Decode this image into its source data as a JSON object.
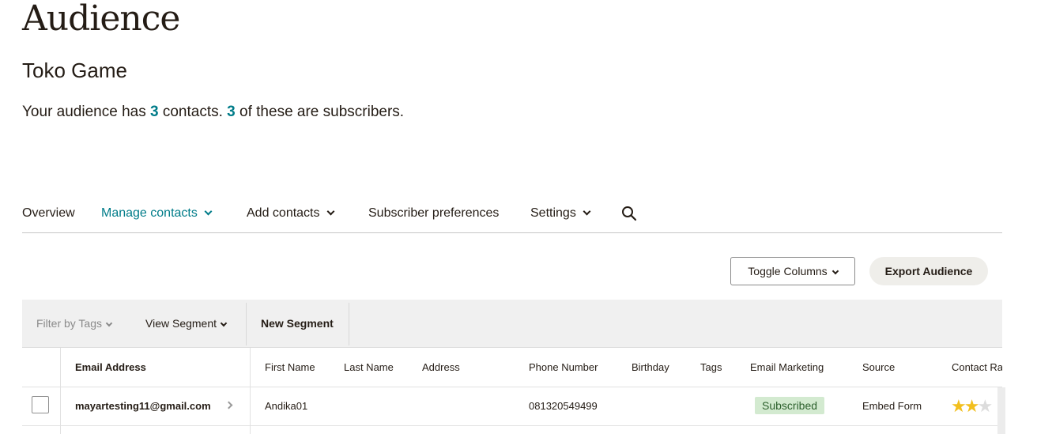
{
  "page": {
    "title": "Audience"
  },
  "audience": {
    "name": "Toko Game"
  },
  "summary": {
    "prefix": "Your audience has ",
    "contacts_count": "3",
    "middle": " contacts. ",
    "subscribers_count": "3",
    "suffix": " of these are subscribers."
  },
  "nav": {
    "items": [
      {
        "label": "Overview"
      },
      {
        "label": "Manage contacts"
      },
      {
        "label": "Add contacts"
      },
      {
        "label": "Subscriber preferences"
      },
      {
        "label": "Settings"
      }
    ],
    "active_index": 1,
    "search_icon": "search-icon"
  },
  "toolbar": {
    "toggle_columns": "Toggle Columns",
    "export_audience": "Export Audience"
  },
  "filters": {
    "filter_by_tags": "Filter by Tags",
    "view_segment": "View Segment",
    "new_segment": "New Segment"
  },
  "table": {
    "columns": [
      "Email Address",
      "First Name",
      "Last Name",
      "Address",
      "Phone Number",
      "Birthday",
      "Tags",
      "Email Marketing",
      "Source",
      "Contact Ra"
    ],
    "rows": [
      {
        "email": "mayartesting11@gmail.com",
        "first_name": "Andika01",
        "last_name": "",
        "address": "",
        "phone": "081320549499",
        "birthday": "",
        "tags": "",
        "email_marketing": "Subscribed",
        "source": "Embed Form",
        "contact_rating": 2,
        "contact_rating_max": 3
      }
    ]
  },
  "colors": {
    "accent": "#007c89",
    "subscribed_badge_bg": "#d3ead0",
    "star": "#f2bf1e"
  }
}
